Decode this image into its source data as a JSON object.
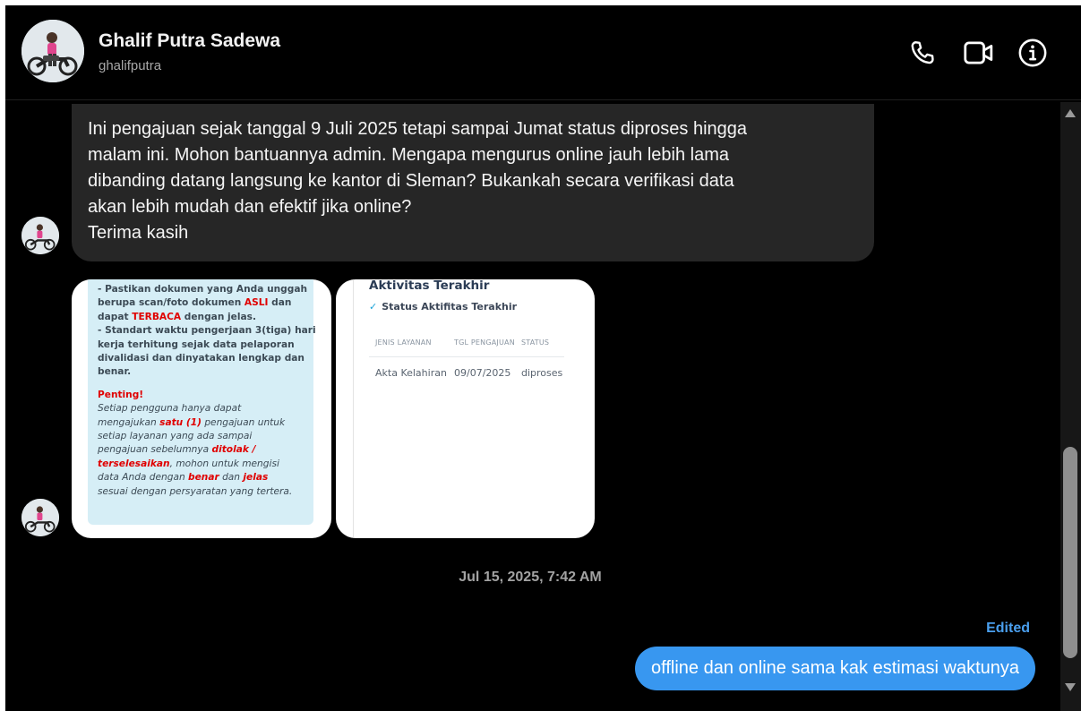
{
  "header": {
    "name": "Ghalif Putra Sadewa",
    "username": "ghalifputra",
    "icons": [
      "phone-icon",
      "video-icon",
      "info-icon"
    ]
  },
  "messages": {
    "incoming_text_lines": [
      "Ini pengajuan sejak tanggal 9 Juli 2025 tetapi sampai Jumat status diproses hingga",
      "malam ini. Mohon bantuannya admin. Mengapa mengurus online jauh lebih lama",
      "dibanding datang langsung ke kantor di Sleman? Bukankah secara verifikasi data",
      "akan lebih mudah dan efektif jika online?",
      "Terima kasih"
    ],
    "attachment1": {
      "l1": "- Pastikan dokumen yang Anda unggah",
      "l2a": "berupa scan/foto dokumen ",
      "l2b": "ASLI",
      "l2c": " dan",
      "l3a": "dapat ",
      "l3b": "TERBACA",
      "l3c": " dengan jelas.",
      "l4": "- Standart waktu pengerjaan 3(tiga) hari",
      "l5": "kerja terhitung sejak data pelaporan",
      "l6": "divalidasi dan dinyatakan lengkap dan",
      "l7": "benar.",
      "penting": "Penting!",
      "i1": "Setiap pengguna hanya dapat",
      "i2a": "mengajukan ",
      "i2b": "satu (1)",
      "i2c": " pengajuan untuk",
      "i3": "setiap layanan yang ada sampai",
      "i4a": "pengajuan sebelumnya ",
      "i4b": "ditolak /",
      "i5a": "terselesaikan",
      "i5b": ", mohon untuk mengisi",
      "i6a": "data Anda dengan ",
      "i6b": "benar",
      "i6c": " dan ",
      "i6d": "jelas",
      "i7": "sesuai dengan persyaratan yang tertera."
    },
    "attachment2": {
      "title": "Aktivitas Terakhir",
      "subtitle": "Status Aktifitas Terakhir",
      "headers": [
        "JENIS LAYANAN",
        "TGL PENGAJUAN",
        "STATUS"
      ],
      "row": [
        "Akta Kelahiran",
        "09/07/2025",
        "diproses"
      ]
    },
    "timestamp": "Jul 15, 2025, 7:42 AM",
    "edited_label": "Edited",
    "outgoing_text": "offline dan online sama kak estimasi waktunya"
  },
  "colors": {
    "background": "#000000",
    "incoming_bubble": "#262626",
    "outgoing_bubble": "#3897f0",
    "edited": "#4a9fee"
  }
}
